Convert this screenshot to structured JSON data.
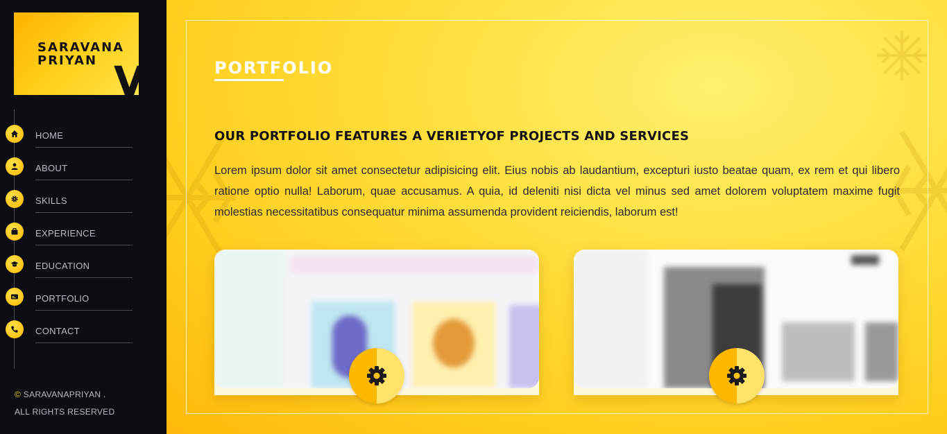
{
  "brand": {
    "line1": "SARAVANA",
    "line2": "PRIYAN",
    "mark": "V"
  },
  "nav": [
    {
      "label": "HOME",
      "icon": "home-icon"
    },
    {
      "label": "ABOUT",
      "icon": "user-icon"
    },
    {
      "label": "SKILLS",
      "icon": "gear-icon"
    },
    {
      "label": "EXPERIENCE",
      "icon": "briefcase-icon"
    },
    {
      "label": "EDUCATION",
      "icon": "graduation-cap-icon"
    },
    {
      "label": "PORTFOLIO",
      "icon": "id-card-icon"
    },
    {
      "label": "CONTACT",
      "icon": "phone-icon"
    }
  ],
  "footer": {
    "symbol": "©",
    "line1": "SARAVANAPRIYAN .",
    "line2": "ALL RIGHTS RESERVED"
  },
  "main": {
    "section_title": "PORTFOLIO",
    "heading": "OUR PORTFOLIO FEATURES A VERIETYOF PROJECTS AND SERVICES",
    "body": "Lorem ipsum dolor sit amet consectetur adipisicing elit. Eius nobis ab laudantium, excepturi iusto beatae quam, ex rem et qui libero ratione optio nulla! Laborum, quae accusamus. A quia, id deleniti nisi dicta vel minus sed amet dolorem voluptatem maxime fugit molestias necessitatibus consequatur minima assumenda provident reiciendis, laborum est!",
    "cards": [
      {
        "icon": "gear-icon"
      },
      {
        "icon": "gear-icon"
      }
    ]
  },
  "colors": {
    "accent": "#ffc21a",
    "sidebar": "#0b0d12",
    "text": "#121212"
  }
}
